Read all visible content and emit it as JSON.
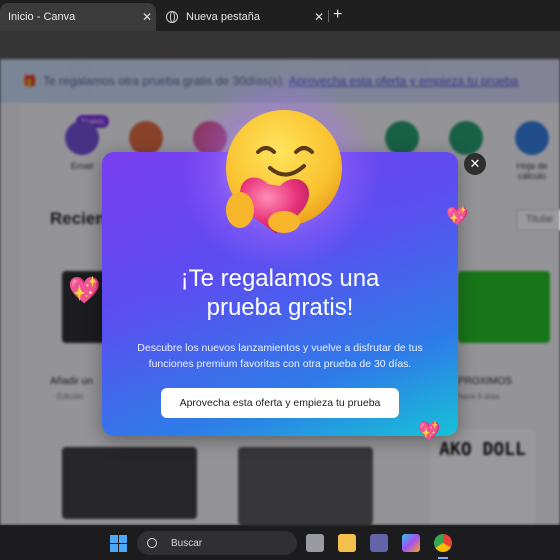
{
  "browser": {
    "tabs": [
      {
        "label": "Inicio - Canva",
        "active": true
      },
      {
        "label": "Nueva pestaña",
        "active": false
      }
    ],
    "new_tab_symbol": "+",
    "close_symbol": "✕"
  },
  "page": {
    "banner": {
      "text": "Te regalamos otra prueba gratis de 30días(s).",
      "link": "Aprovecha esta oferta y empieza tu prueba"
    },
    "shortcuts": [
      {
        "label": "Email",
        "color": "#6f4ad8"
      },
      {
        "label": "",
        "color": "#e2683c"
      },
      {
        "label": "",
        "color": "#e04f8a"
      },
      {
        "label": "",
        "color": "#3aa3d6"
      },
      {
        "label": "",
        "color": "#1f9e6b"
      },
      {
        "label": "",
        "color": "#1f9e6b"
      },
      {
        "label": "Hoja de cálculo",
        "color": "#2f7de0"
      }
    ],
    "badge_new": "Nuevo",
    "recent_heading": "Recien",
    "sort_label": "Titular",
    "cards": [
      {
        "title": "Añadir un",
        "sub": "· Edición"
      },
      {
        "title": "PROXIMOS",
        "sub": "hace 6 días"
      }
    ],
    "card_text_akodoll": "AKO DOLL"
  },
  "modal": {
    "title_line1": "¡Te regalamos una",
    "title_line2": "prueba gratis!",
    "description": "Descubre los nuevos lanzamientos y vuelve a disfrutar de tus funciones premium favoritas con otra prueba de 30 días.",
    "cta": "Aprovecha esta oferta y empieza tu prueba",
    "close": "✕",
    "emoji": "smiling-face-hugging-heart"
  },
  "taskbar": {
    "search_placeholder": "Buscar",
    "apps": [
      "start-icon",
      "search-icon",
      "task-view-icon",
      "file-explorer-icon",
      "teams-icon",
      "copilot-icon",
      "chrome-icon"
    ]
  }
}
